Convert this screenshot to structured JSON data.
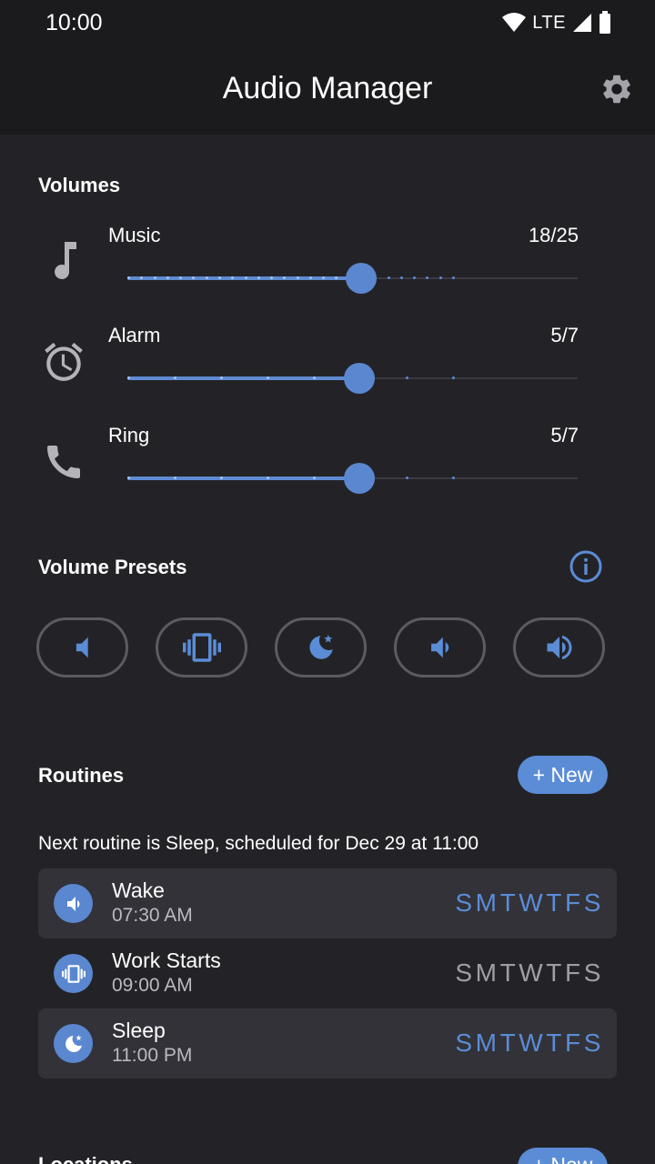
{
  "status_bar": {
    "time": "10:00",
    "network": "LTE"
  },
  "app": {
    "title": "Audio Manager",
    "settings_icon": "gear-icon"
  },
  "volumes": {
    "title": "Volumes",
    "items": [
      {
        "label": "Music",
        "value_text": "18/25",
        "current": 18,
        "max": 25,
        "icon": "music-note-icon"
      },
      {
        "label": "Alarm",
        "value_text": "5/7",
        "current": 5,
        "max": 7,
        "icon": "alarm-clock-icon"
      },
      {
        "label": "Ring",
        "value_text": "5/7",
        "current": 5,
        "max": 7,
        "icon": "phone-icon"
      }
    ]
  },
  "presets": {
    "title": "Volume Presets",
    "info_icon": "info-icon",
    "buttons": [
      {
        "icon": "volume-mute-icon"
      },
      {
        "icon": "vibrate-icon"
      },
      {
        "icon": "moon-star-icon"
      },
      {
        "icon": "volume-low-icon"
      },
      {
        "icon": "volume-high-icon"
      }
    ]
  },
  "routines": {
    "title": "Routines",
    "new_label": "+ New",
    "next_text": "Next routine is Sleep, scheduled for Dec 29 at 11:00",
    "items": [
      {
        "name": "Wake",
        "time": "07:30 AM",
        "days": "SMTWTFS",
        "enabled": true,
        "icon": "volume-low-icon"
      },
      {
        "name": "Work Starts",
        "time": "09:00 AM",
        "days": "SMTWTFS",
        "enabled": false,
        "icon": "vibrate-icon"
      },
      {
        "name": "Sleep",
        "time": "11:00 PM",
        "days": "SMTWTFS",
        "enabled": true,
        "icon": "moon-star-icon"
      }
    ]
  },
  "next_section": {
    "title": "Locations",
    "new_label": "+ New"
  },
  "colors": {
    "accent": "#5b8cd6",
    "background": "#232327",
    "appbar": "#1b1b1e"
  }
}
